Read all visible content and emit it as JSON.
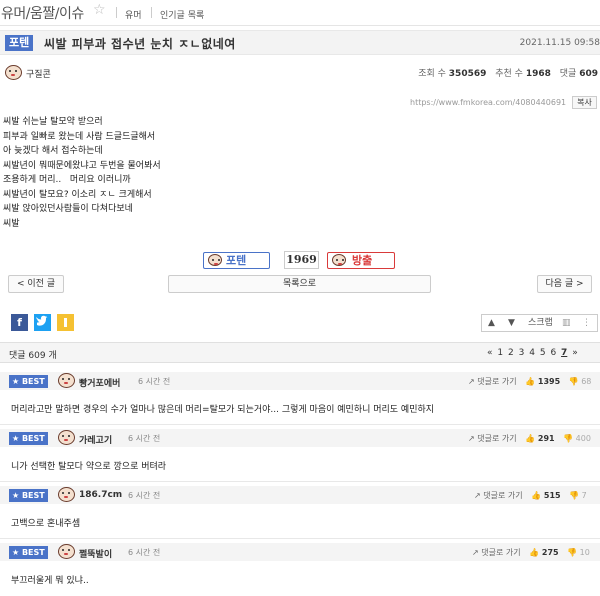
{
  "header": {
    "board_title": "유머/움짤/이슈",
    "star": "☆",
    "crumb1": "유머",
    "crumb2": "인기글 목록"
  },
  "post": {
    "tag": "포텐",
    "title": "씨발 피부과 접수년 눈치 ㅈㄴ없네여",
    "date": "2021.11.15 09:58",
    "author": "구질콘",
    "views_label": "조회 수",
    "views": "350569",
    "recommend_label": "추천 수",
    "recommend": "1968",
    "comments_label": "댓글",
    "comments": "609",
    "url": "https://www.fmkorea.com/4080440691",
    "copy_label": "복사",
    "body": "씨발 쉬는날 탈모약 받으러\n피부과 일빠로 왔는데 사람 드글드글해서\n아 늦겠다 해서 접수하는데\n씨발년이 뭐때문에왔냐고 두번을 물어봐서\n조용하게 머리..   머리요 이러니까\n씨발년이 탈모요? 이소리 ㅈㄴ 크게해서\n씨발 앉아있던사람들이 다쳐다보네\n씨발"
  },
  "vote": {
    "up_label": "포텐",
    "count": "1969",
    "down_label": "방출"
  },
  "nav": {
    "prev": "< 이전 글",
    "list": "목록으로",
    "next": "다음 글 >"
  },
  "tools": {
    "scrap": "스크랩"
  },
  "comment_bar": {
    "count": "댓글 609 개",
    "pager_prev": "«",
    "pages": [
      "1",
      "2",
      "3",
      "4",
      "5",
      "6"
    ],
    "current_page": "7",
    "pager_next": "»"
  },
  "comments": [
    {
      "badge": "★ BEST",
      "name": "빵거포에버",
      "time": "6 시간 전",
      "reply": "댓글로 가기",
      "up": "1395",
      "down": "68",
      "text": "머리라고만 말하면 경우의 수가 얼마나 많은데 머리=탈모가 되는거야... 그렇게 마음이 예민하니 머리도 예민하지"
    },
    {
      "badge": "★ BEST",
      "name": "가레고기",
      "time": "6 시간 전",
      "reply": "댓글로 가기",
      "up": "291",
      "down": "400",
      "text": "니가 선택한 탈모다 약으로 깡으로 버텨라"
    },
    {
      "badge": "★ BEST",
      "name": "186.7cm",
      "time": "6 시간 전",
      "reply": "댓글로 가기",
      "up": "515",
      "down": "7",
      "text": "고백으로 혼내주셈"
    },
    {
      "badge": "★ BEST",
      "name": "쩔뚝발이",
      "time": "6 시간 전",
      "reply": "댓글로 가기",
      "up": "275",
      "down": "10",
      "text": "부끄러울게 뭐 있냐.."
    }
  ]
}
